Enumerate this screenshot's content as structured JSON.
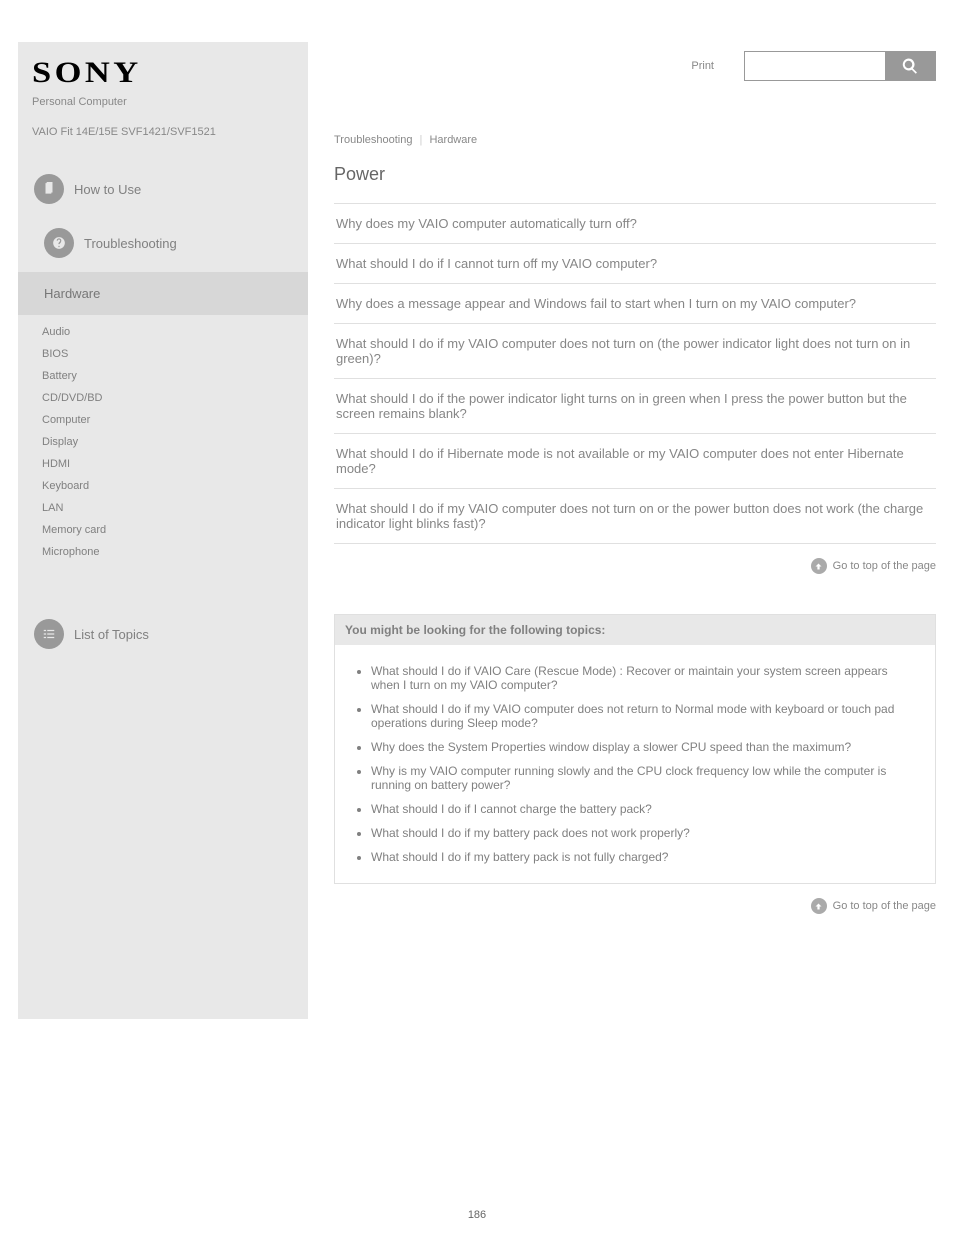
{
  "sidebar": {
    "logo_text": "SONY",
    "pc_label": "Personal Computer",
    "model_label": "VAIO Fit 14E/15E  SVF1421/SVF1521",
    "items": [
      {
        "label": "How to Use"
      },
      {
        "label": "Troubleshooting"
      },
      {
        "label": "Hardware"
      }
    ],
    "sub_items": [
      "Audio",
      "BIOS",
      "Battery",
      "CD/DVD/BD",
      "Computer",
      "Display",
      "HDMI",
      "Keyboard",
      "LAN",
      "Memory card",
      "Microphone"
    ],
    "contents_label": "List of Topics"
  },
  "topbar": {
    "print_label": "Print",
    "search_placeholder": ""
  },
  "breadcrumb": {
    "part1": "Troubleshooting",
    "part2": "Hardware"
  },
  "page_title": "Power",
  "accordion": [
    "Why does my VAIO computer automatically turn off?",
    "What should I do if I cannot turn off my VAIO computer?",
    "Why does a message appear and Windows fail to start when I turn on my VAIO computer?",
    "What should I do if my VAIO computer does not turn on (the power indicator light does not turn on in green)?",
    "What should I do if the power indicator light turns on in green when I press the power button but the screen remains blank?",
    "What should I do if Hibernate mode is not available or my VAIO computer does not enter Hibernate mode?",
    "What should I do if my VAIO computer does not turn on or the power button does not work (the charge indicator light blinks fast)?"
  ],
  "related": {
    "header": "You might be looking for the following topics:",
    "items": [
      "What should I do if VAIO Care (Rescue Mode) : Recover or maintain your system screen appears when I turn on my VAIO computer?",
      "What should I do if my VAIO computer does not return to Normal mode with keyboard or touch pad operations during Sleep mode?",
      "Why does the System Properties window display a slower CPU speed than the maximum?",
      "Why is my VAIO computer running slowly and the CPU clock frequency low while the computer is running on battery power?",
      "What should I do if I cannot charge the battery pack?",
      "What should I do if my battery pack does not work properly?",
      "What should I do if my battery pack is not fully charged?"
    ]
  },
  "goto_top_label": "Go to top of the page",
  "page_number": "186"
}
